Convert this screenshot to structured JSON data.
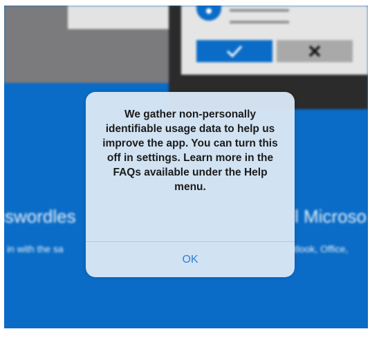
{
  "background": {
    "headline_left": "sswordles",
    "headline_right": "l Microso",
    "subtext_left": "in with the sa",
    "subtext_right": "utlook, Office,"
  },
  "illustration": {
    "approve_icon": "checkmark-icon",
    "deny_icon": "x-icon",
    "shield_icon": "shield-icon"
  },
  "dialog": {
    "message": "We gather non-personally identifiable usage data to help us improve the app. You can turn this off in settings. Learn more in the FAQs available under the Help menu.",
    "ok_label": "OK"
  },
  "colors": {
    "brand_blue": "#0a6cc6",
    "dialog_bg": "#d8e6f4",
    "button_text": "#2f7fd8"
  }
}
